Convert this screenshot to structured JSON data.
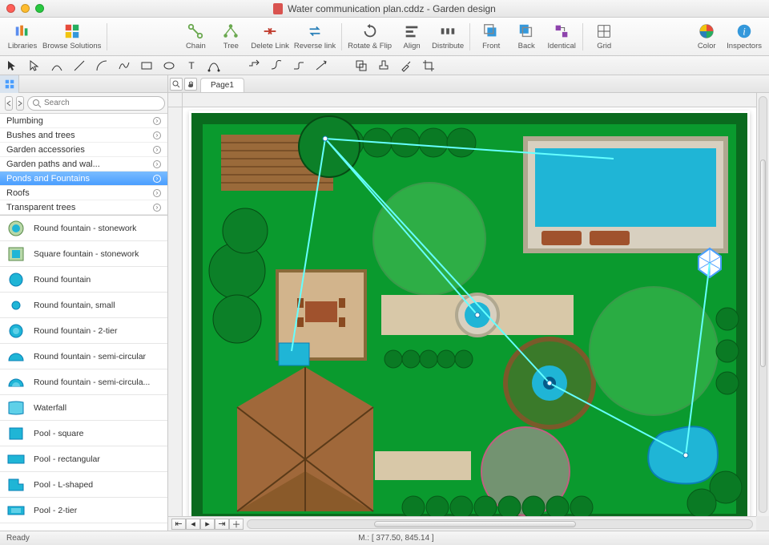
{
  "window": {
    "title": "Water communication plan.cddz - Garden design"
  },
  "toolbar": {
    "libraries": "Libraries",
    "browse_solutions": "Browse Solutions",
    "chain": "Chain",
    "tree": "Tree",
    "delete_link": "Delete Link",
    "reverse_link": "Reverse link",
    "rotate_flip": "Rotate & Flip",
    "align": "Align",
    "distribute": "Distribute",
    "front": "Front",
    "back": "Back",
    "identical": "Identical",
    "grid": "Grid",
    "color": "Color",
    "inspectors": "Inspectors"
  },
  "sidebar": {
    "search_placeholder": "Search",
    "categories": [
      "Plumbing",
      "Bushes and trees",
      "Garden accessories",
      "Garden paths and wal...",
      "Ponds and Fountains",
      "Roofs",
      "Transparent trees"
    ],
    "selected_index": 4,
    "stencils": [
      "Round fountain - stonework",
      "Square fountain - stonework",
      "Round fountain",
      "Round fountain, small",
      "Round fountain - 2-tier",
      "Round fountain - semi-circular",
      "Round fountain - semi-circula...",
      "Waterfall",
      "Pool - square",
      "Pool - rectangular",
      "Pool - L-shaped",
      "Pool - 2-tier"
    ]
  },
  "canvas": {
    "tab": "Page1"
  },
  "status": {
    "ready": "Ready",
    "coords": "M.: [ 377.50, 845.14 ]"
  },
  "colors": {
    "accent": "#4a9eff",
    "green": "#0a8a2a",
    "pool": "#1fb5d6",
    "water": "#0a7fb5"
  }
}
